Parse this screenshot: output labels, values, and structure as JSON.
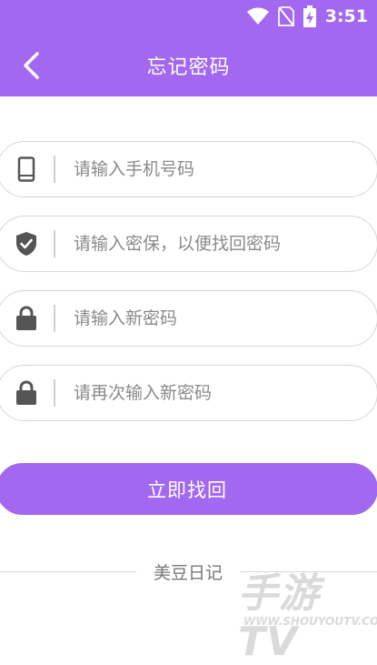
{
  "status_bar": {
    "time": "3:51"
  },
  "header": {
    "title": "忘记密码"
  },
  "form": {
    "phone_placeholder": "请输入手机号码",
    "security_placeholder": "请输入密保，以便找回密码",
    "new_password_placeholder": "请输入新密码",
    "confirm_password_placeholder": "请再次输入新密码",
    "submit_label": "立即找回"
  },
  "footer": {
    "text": "美豆日记"
  },
  "watermark": {
    "main": "手游TV",
    "sub": "WWW.SHOUYOUTV.COM"
  },
  "icons": {
    "back": "chevron-left-icon",
    "phone": "phone-icon",
    "security": "shield-check-icon",
    "lock": "lock-icon",
    "wifi": "wifi-icon",
    "sim": "no-sim-icon",
    "battery": "battery-charging-icon"
  },
  "colors": {
    "accent": "#a368f0",
    "icon": "#555555"
  }
}
